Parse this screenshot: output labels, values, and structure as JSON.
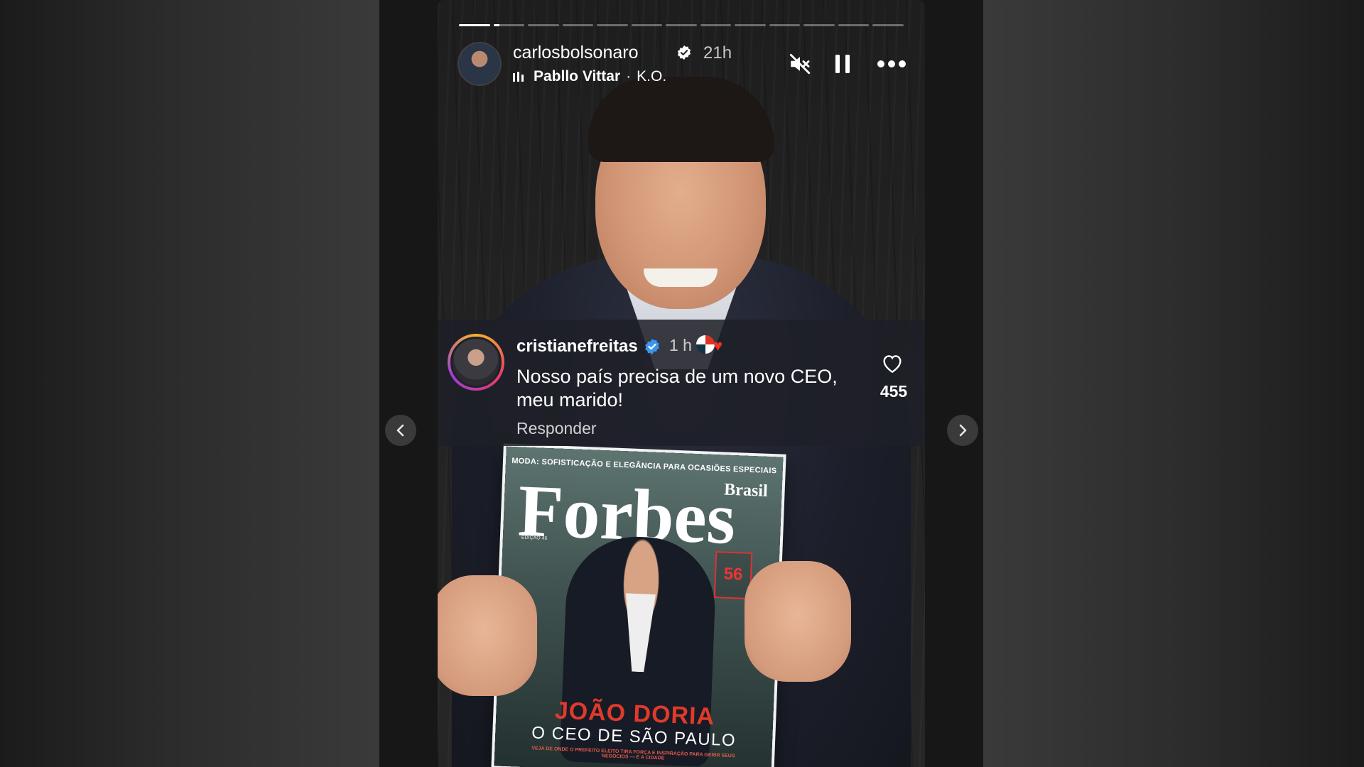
{
  "story": {
    "progress": {
      "segments": 13,
      "active_index": 0,
      "active_fill": 1.0,
      "next_fill": 0.2
    },
    "header": {
      "username": "carlosbolsonaro",
      "verified": true,
      "timestamp": "21h",
      "music": {
        "artist": "Pabllo Vittar",
        "separator": "·",
        "track": "K.O."
      },
      "buttons": {
        "mute_icon": "speaker-muted-icon",
        "pause_icon": "pause-icon",
        "more_icon": "more-horizontal-icon"
      }
    },
    "comment": {
      "username": "cristianefreitas",
      "verified": true,
      "time": "1 h",
      "emojis": [
        "uk-flag-emoji",
        "red-heart-emoji"
      ],
      "text": "Nosso país precisa de um novo CEO, meu marido!",
      "reply_label": "Responder",
      "likes": "455"
    },
    "magazine": {
      "topline": "MODA: SOFISTICAÇÃO E ELEGÂNCIA PARA OCASIÕES ESPECIAIS",
      "logo": "Forbes",
      "edition_region": "Brasil",
      "edition": "EDIÇÃO 46",
      "badge": "56",
      "headline": "JOÃO DORIA",
      "subheadline": "O CEO DE SÃO PAULO",
      "tagline": "VEJA DE ONDE O PREFEITO ELEITO TIRA FORÇA E INSPIRAÇÃO PARA GERIR SEUS NEGÓCIOS — E A CIDADE"
    }
  },
  "navigation": {
    "prev_icon": "chevron-left-icon",
    "next_icon": "chevron-right-icon"
  },
  "colors": {
    "background": "#121212",
    "overlay": "#1e2028",
    "verified_blue": "#3897f0",
    "headline_red": "#e03a2a"
  }
}
